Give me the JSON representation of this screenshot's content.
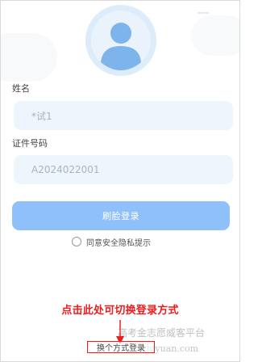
{
  "form": {
    "name_label": "姓名",
    "name_value": "*试1",
    "id_label": "证件号码",
    "id_value": "A2024022001",
    "face_login_button": "刷脸登录",
    "agree_text": "同意安全隐私提示"
  },
  "annotation": {
    "hint_text": "点击此处可切换登录方式",
    "switch_link": "换个方式登录",
    "hint_color": "#ee1c1c"
  },
  "watermark": {
    "text": "高考金志愿威客平台",
    "url": "zhiyuan.com"
  },
  "colors": {
    "input_bg": "#eef5fd",
    "button_bg": "#8fc0fa",
    "avatar_bg": "#dcecfa",
    "avatar_fg": "#7db4ec"
  }
}
